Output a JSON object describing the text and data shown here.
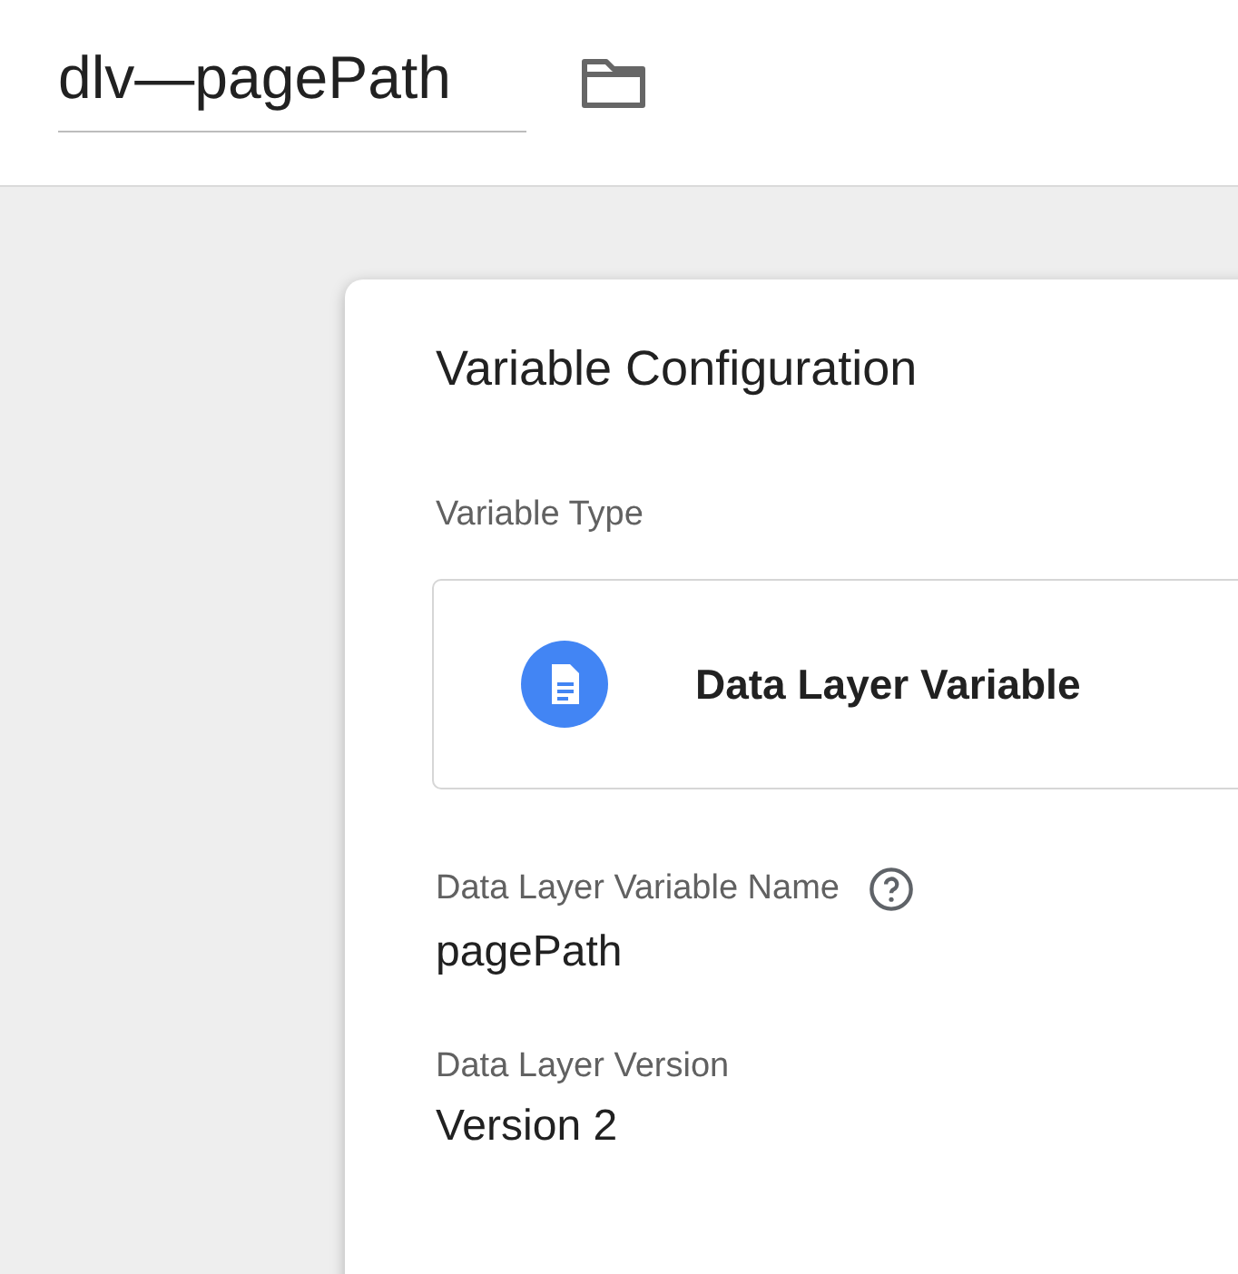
{
  "header": {
    "title": "dlv—pagePath"
  },
  "card": {
    "title": "Variable Configuration",
    "variable_type": {
      "label": "Variable Type",
      "value": "Data Layer Variable"
    },
    "fields": [
      {
        "label": "Data Layer Variable Name",
        "help": true,
        "value": "pagePath"
      },
      {
        "label": "Data Layer Version",
        "help": false,
        "value": "Version 2"
      }
    ]
  }
}
